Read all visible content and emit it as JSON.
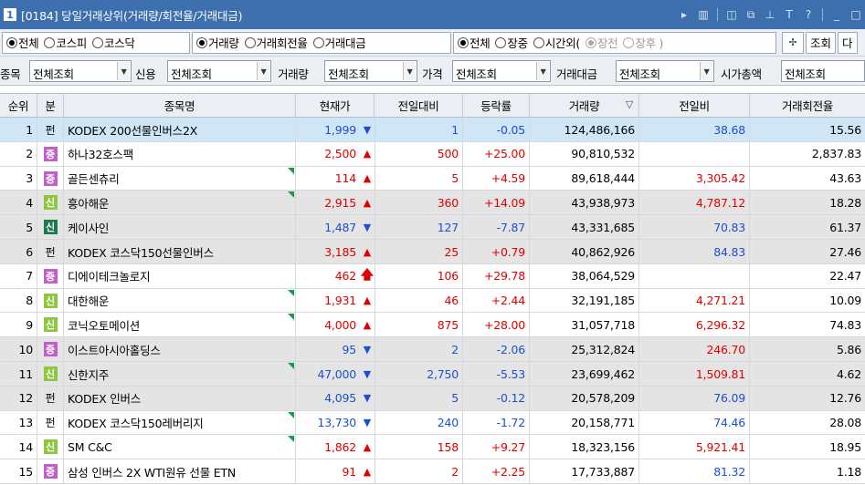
{
  "window": {
    "number": "1",
    "title": "[0184] 당일거래상위(거래량/회전율/거래대금)",
    "icons": [
      "play-icon",
      "grid-icon",
      "window-icon",
      "link-icon",
      "pin-icon",
      "font-icon",
      "help-icon",
      "minimize-icon",
      "maximize-icon"
    ]
  },
  "toolbar": {
    "market": {
      "options": [
        "전체",
        "코스피",
        "코스닥"
      ],
      "selected": "전체"
    },
    "metric": {
      "options": [
        "거래량",
        "거래회전율",
        "거래대금"
      ],
      "selected": "거래량"
    },
    "session": {
      "options": [
        "전체",
        "장중",
        "시간외("
      ],
      "selected": "전체",
      "sub_options": [
        "장전",
        "장후 )"
      ],
      "sub_selected": "장전"
    },
    "query_label": "조회",
    "next_label": "다"
  },
  "filters": {
    "item_label": "종목",
    "item_value": "전체조회",
    "credit_label": "신용",
    "credit_value": "전체조회",
    "volume_label": "거래량",
    "volume_value": "전체조회",
    "price_label": "가격",
    "price_value": "전체조회",
    "amount_label": "거래대금",
    "amount_value": "전체조회",
    "cap_label": "시가총액",
    "cap_value": "전체조회"
  },
  "table": {
    "headers": {
      "rank": "순위",
      "cat": "분",
      "name": "종목명",
      "price": "현재가",
      "change": "전일대비",
      "rate": "등락률",
      "volume": "거래량",
      "prev_ratio": "전일비",
      "turnover": "거래회전율"
    },
    "rows": [
      {
        "rank": "1",
        "cat": "펀",
        "cat_type": "fund",
        "name": "KODEX 200선물인버스2X",
        "flag": false,
        "price": "1,999",
        "dir": "down",
        "change": "1",
        "rate": "-0.05",
        "volume": "124,486,166",
        "prev_ratio": "38.68",
        "prev_dir": "down",
        "turnover": "15.56",
        "style": "sel"
      },
      {
        "rank": "2",
        "cat": "증",
        "cat_type": "jeung",
        "name": "하나32호스팩",
        "flag": false,
        "price": "2,500",
        "dir": "up",
        "change": "500",
        "rate": "+25.00",
        "volume": "90,810,532",
        "prev_ratio": "",
        "prev_dir": "up",
        "turnover": "2,837.83",
        "style": ""
      },
      {
        "rank": "3",
        "cat": "증",
        "cat_type": "jeung",
        "name": "골든센츄리",
        "flag": true,
        "price": "114",
        "dir": "up",
        "change": "5",
        "rate": "+4.59",
        "volume": "89,618,444",
        "prev_ratio": "3,305.42",
        "prev_dir": "up",
        "turnover": "43.63",
        "style": ""
      },
      {
        "rank": "4",
        "cat": "신",
        "cat_type": "sin",
        "name": "흥아해운",
        "flag": true,
        "price": "2,915",
        "dir": "up",
        "change": "360",
        "rate": "+14.09",
        "volume": "43,938,973",
        "prev_ratio": "4,787.12",
        "prev_dir": "up",
        "turnover": "18.28",
        "style": "shade"
      },
      {
        "rank": "5",
        "cat": "신",
        "cat_type": "sin2",
        "name": "케이사인",
        "flag": false,
        "price": "1,487",
        "dir": "down",
        "change": "127",
        "rate": "-7.87",
        "volume": "43,331,685",
        "prev_ratio": "70.83",
        "prev_dir": "down",
        "turnover": "61.37",
        "style": "shade"
      },
      {
        "rank": "6",
        "cat": "펀",
        "cat_type": "fund",
        "name": "KODEX 코스닥150선물인버스",
        "flag": false,
        "price": "3,185",
        "dir": "up",
        "change": "25",
        "rate": "+0.79",
        "volume": "40,862,926",
        "prev_ratio": "84.83",
        "prev_dir": "down",
        "turnover": "27.46",
        "style": "shade"
      },
      {
        "rank": "7",
        "cat": "증",
        "cat_type": "jeung",
        "name": "디에이테크놀로지",
        "flag": false,
        "price": "462",
        "dir": "upper",
        "change": "106",
        "rate": "+29.78",
        "volume": "38,064,529",
        "prev_ratio": "",
        "prev_dir": "up",
        "turnover": "22.47",
        "style": ""
      },
      {
        "rank": "8",
        "cat": "신",
        "cat_type": "sin",
        "name": "대한해운",
        "flag": true,
        "price": "1,931",
        "dir": "up",
        "change": "46",
        "rate": "+2.44",
        "volume": "32,191,185",
        "prev_ratio": "4,271.21",
        "prev_dir": "up",
        "turnover": "10.09",
        "style": ""
      },
      {
        "rank": "9",
        "cat": "신",
        "cat_type": "sin",
        "name": "코닉오토메이션",
        "flag": true,
        "price": "4,000",
        "dir": "up",
        "change": "875",
        "rate": "+28.00",
        "volume": "31,057,718",
        "prev_ratio": "6,296.32",
        "prev_dir": "up",
        "turnover": "74.83",
        "style": ""
      },
      {
        "rank": "10",
        "cat": "증",
        "cat_type": "jeung",
        "name": "이스트아시아홀딩스",
        "flag": false,
        "price": "95",
        "dir": "down",
        "change": "2",
        "rate": "-2.06",
        "volume": "25,312,824",
        "prev_ratio": "246.70",
        "prev_dir": "up",
        "turnover": "5.86",
        "style": "shade"
      },
      {
        "rank": "11",
        "cat": "신",
        "cat_type": "sin",
        "name": "신한지주",
        "flag": true,
        "price": "47,000",
        "dir": "down",
        "change": "2,750",
        "rate": "-5.53",
        "volume": "23,699,462",
        "prev_ratio": "1,509.81",
        "prev_dir": "up",
        "turnover": "4.62",
        "style": "shade"
      },
      {
        "rank": "12",
        "cat": "펀",
        "cat_type": "fund",
        "name": "KODEX 인버스",
        "flag": false,
        "price": "4,095",
        "dir": "down",
        "change": "5",
        "rate": "-0.12",
        "volume": "20,578,209",
        "prev_ratio": "76.09",
        "prev_dir": "down",
        "turnover": "12.76",
        "style": "shade"
      },
      {
        "rank": "13",
        "cat": "펀",
        "cat_type": "fund",
        "name": "KODEX 코스닥150레버리지",
        "flag": true,
        "price": "13,730",
        "dir": "down",
        "change": "240",
        "rate": "-1.72",
        "volume": "20,158,771",
        "prev_ratio": "74.46",
        "prev_dir": "down",
        "turnover": "28.08",
        "style": ""
      },
      {
        "rank": "14",
        "cat": "신",
        "cat_type": "sin",
        "name": "SM C&C",
        "flag": true,
        "price": "1,862",
        "dir": "up",
        "change": "158",
        "rate": "+9.27",
        "volume": "18,323,156",
        "prev_ratio": "5,921.41",
        "prev_dir": "up",
        "turnover": "18.95",
        "style": ""
      },
      {
        "rank": "15",
        "cat": "증",
        "cat_type": "jeung",
        "name": "삼성 인버스 2X WTI원유 선물 ETN",
        "flag": false,
        "price": "91",
        "dir": "up",
        "change": "2",
        "rate": "+2.25",
        "volume": "17,733,887",
        "prev_ratio": "81.32",
        "prev_dir": "down",
        "turnover": "1.18",
        "style": ""
      }
    ]
  }
}
